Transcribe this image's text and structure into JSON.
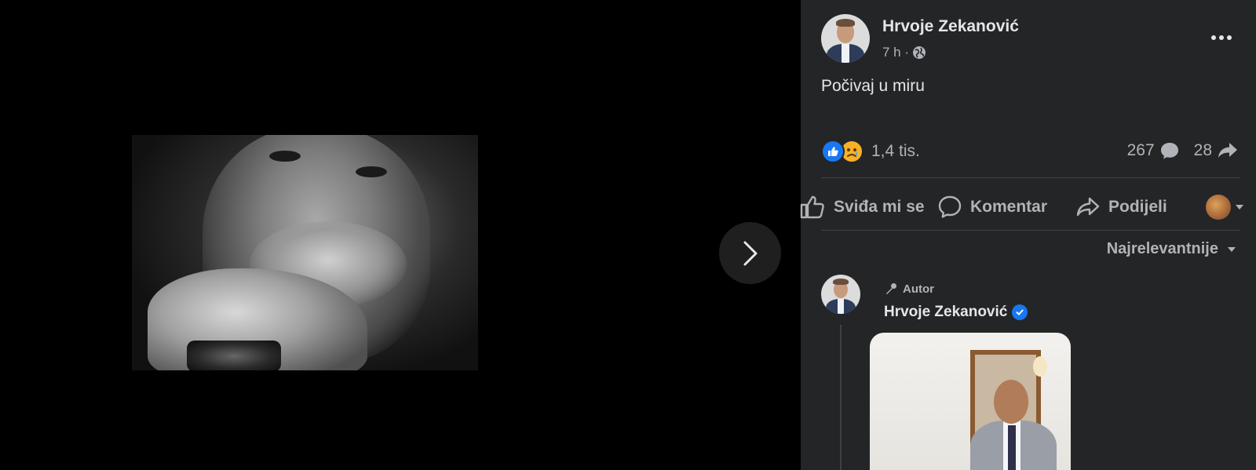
{
  "post": {
    "author": "Hrvoje Zekanović",
    "time": "7 h ·",
    "privacy_icon": "globe-icon",
    "text": "Počivaj u miru"
  },
  "stats": {
    "reactions_count": "1,4 tis.",
    "reaction_types": [
      "like",
      "sad"
    ],
    "comments_count": "267",
    "shares_count": "28"
  },
  "actions": {
    "like_label": "Sviđa mi se",
    "comment_label": "Komentar",
    "share_label": "Podijeli"
  },
  "comments": {
    "sort_label": "Najrelevantnije",
    "first": {
      "badge": "Autor",
      "author": "Hrvoje Zekanović",
      "verified": true
    }
  },
  "colors": {
    "panel_bg": "#242526",
    "text_primary": "#e4e6eb",
    "text_secondary": "#b0b3b8",
    "accent": "#1877f2"
  }
}
